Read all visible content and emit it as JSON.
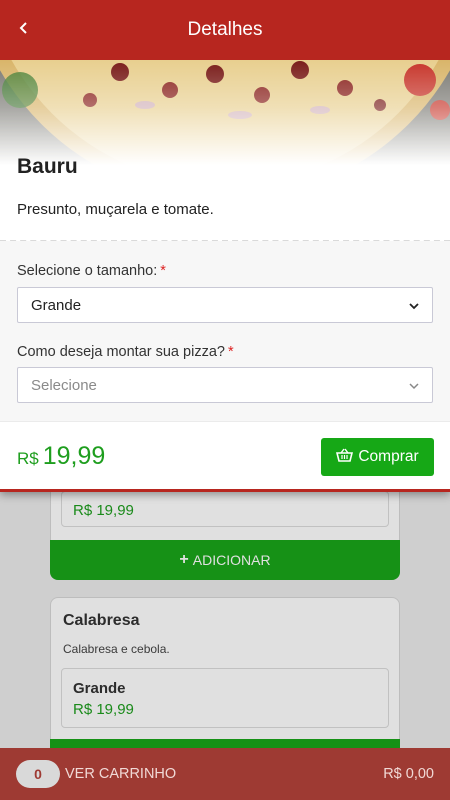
{
  "header": {
    "title": "Detalhes",
    "back_icon": "chevron-left-icon"
  },
  "product": {
    "name": "Bauru",
    "description": "Presunto, muçarela e tomate."
  },
  "options": {
    "size_label": "Selecione o tamanho:",
    "size_required_mark": "*",
    "size_value": "Grande",
    "mount_label": "Como deseja montar sua pizza?",
    "mount_required_mark": "*",
    "mount_placeholder": "Selecione"
  },
  "purchase": {
    "currency": "R$",
    "price": "19,99",
    "buy_label": "Comprar",
    "buy_icon": "basket-icon"
  },
  "background_list": {
    "partial_card": {
      "price": "R$ 19,99",
      "add_label": "ADICIONAR"
    },
    "card": {
      "name": "Calabresa",
      "description": "Calabresa e cebola.",
      "size_name": "Grande",
      "price": "R$ 19,99"
    }
  },
  "cart": {
    "count": "0",
    "label": "VER CARRINHO",
    "total": "R$ 0,00"
  },
  "colors": {
    "brand_red": "#b7261f",
    "green": "#16a816",
    "cart_bar": "#9e3a33"
  }
}
